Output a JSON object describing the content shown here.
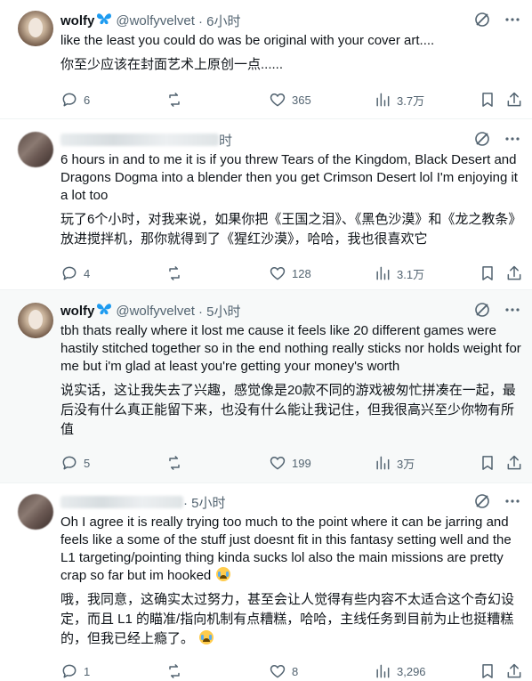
{
  "tweets": [
    {
      "name": "wolfy",
      "handle": "@wolfyvelvet",
      "time": "· 6小时",
      "text": "like the least you could do was be original with your cover art....",
      "translation": "你至少应该在封面艺术上原创一点......",
      "replies": "6",
      "reposts": "",
      "likes": "365",
      "views": "3.7万"
    },
    {
      "name": "",
      "handle": "",
      "time": "时",
      "text": "6 hours in and to me it is if you threw Tears of the Kingdom, Black Desert and Dragons Dogma into a blender then you get Crimson Desert lol I'm enjoying it a lot too",
      "translation": "玩了6个小时，对我来说，如果你把《王国之泪》、《黑色沙漠》和《龙之教条》放进搅拌机，那你就得到了《猩红沙漠》，哈哈，我也很喜欢它",
      "replies": "4",
      "reposts": "",
      "likes": "128",
      "views": "3.1万"
    },
    {
      "name": "wolfy",
      "handle": "@wolfyvelvet",
      "time": "· 5小时",
      "text": "tbh thats really where it lost me cause it feels like 20 different games were hastily stitched together so in the end nothing really sticks nor holds weight for me but i'm glad at least you're getting your money's worth",
      "translation": "说实话，这让我失去了兴趣，感觉像是20款不同的游戏被匆忙拼凑在一起，最后没有什么真正能留下来，也没有什么能让我记住，但我很高兴至少你物有所值",
      "replies": "5",
      "reposts": "",
      "likes": "199",
      "views": "3万"
    },
    {
      "name": "",
      "handle": "",
      "time": "· 5小时",
      "text": "Oh I agree it is really trying too much to the point where it can be jarring and feels like a some of the stuff just doesnt fit in this fantasy setting well and the L1 targeting/pointing thing kinda sucks lol also the main missions are pretty crap so far but im hooked",
      "translation": "哦，我同意，这确实太过努力，甚至会让人觉得有些内容不太适合这个奇幻设定，而且 L1 的瞄准/指向机制有点糟糕，哈哈，主线任务到目前为止也挺糟糕的，但我已经上瘾了。",
      "replies": "1",
      "reposts": "",
      "likes": "8",
      "views": "3,296"
    }
  ],
  "icons": {
    "badge": "butterfly-badge-icon",
    "grok": "grok-icon",
    "more": "more-icon",
    "reply": "reply-icon",
    "repost": "repost-icon",
    "like": "heart-icon",
    "views": "views-icon",
    "bookmark": "bookmark-icon",
    "share": "share-icon",
    "emoji": "crying-face-emoji"
  },
  "colors": {
    "text": "#0f1419",
    "muted": "#536471",
    "badge": "#1d9bf0",
    "shaded_bg": "#f7f9f9"
  }
}
